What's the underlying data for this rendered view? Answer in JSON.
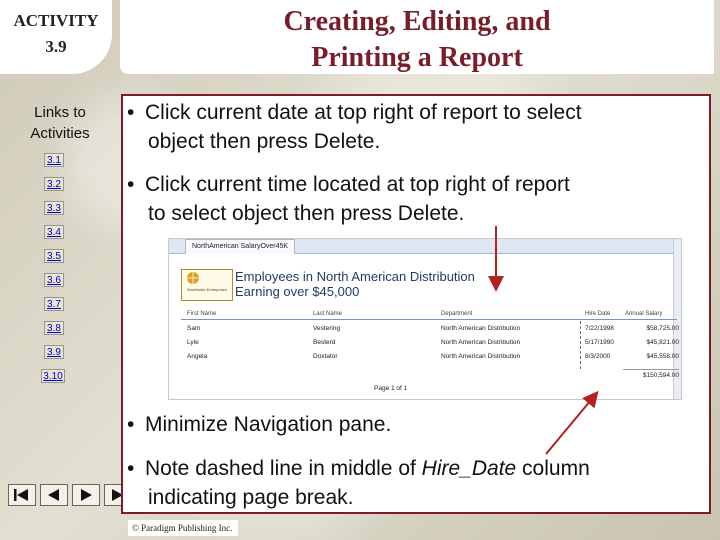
{
  "activity": {
    "line1": "ACTIVITY",
    "line2": "3.9"
  },
  "title": {
    "line1": "Creating, Editing, and",
    "line2": "Printing a Report"
  },
  "sidebar": {
    "label_line1": "Links to",
    "label_line2": "Activities",
    "links": [
      "3.1",
      "3.2",
      "3.3",
      "3.4",
      "3.5",
      "3.6",
      "3.7",
      "3.8",
      "3.9",
      "3.10"
    ]
  },
  "nav_buttons": [
    "first-slide-icon",
    "previous-slide-icon",
    "next-slide-icon",
    "last-slide-icon"
  ],
  "bullets": {
    "b1_line1": "Click current date at top right of report to select",
    "b1_line2": "object then press Delete.",
    "b2_line1": "Click current time located at top right of report",
    "b2_line2": "to select object then press Delete.",
    "b3": "Minimize Navigation pane.",
    "b4_pre": "Note dashed line in middle of ",
    "b4_italic": "Hire_Date",
    "b4_post": " column",
    "b4_line2": "indicating page break."
  },
  "screenshot": {
    "tab": "NorthAmerican SalaryOver45K",
    "logo_text": "Worldwide Enterprises",
    "report_title_line1": "Employees in North American Distribution",
    "report_title_line2": "Earning over $45,000",
    "columns": [
      "First Name",
      "Last Name",
      "Department",
      "Hire Date",
      "Annual Salary"
    ],
    "rows": [
      [
        "Sam",
        "Vestering",
        "North American Distribution",
        "7/22/1998",
        "$58,725.00"
      ],
      [
        "Lyle",
        "Besterd",
        "North American Distribution",
        "5/17/1990",
        "$45,821.00"
      ],
      [
        "Angela",
        "Doxtator",
        "North American Distribution",
        "8/3/2000",
        "$45,558.00"
      ]
    ],
    "total": "$150,594.00",
    "page": "Page 1 of 1"
  },
  "footer": "© Paradigm Publishing Inc.",
  "colors": {
    "title": "#7a1d2a",
    "border": "#7a1d2a",
    "link": "#0000cc",
    "arrow": "#b22222"
  }
}
